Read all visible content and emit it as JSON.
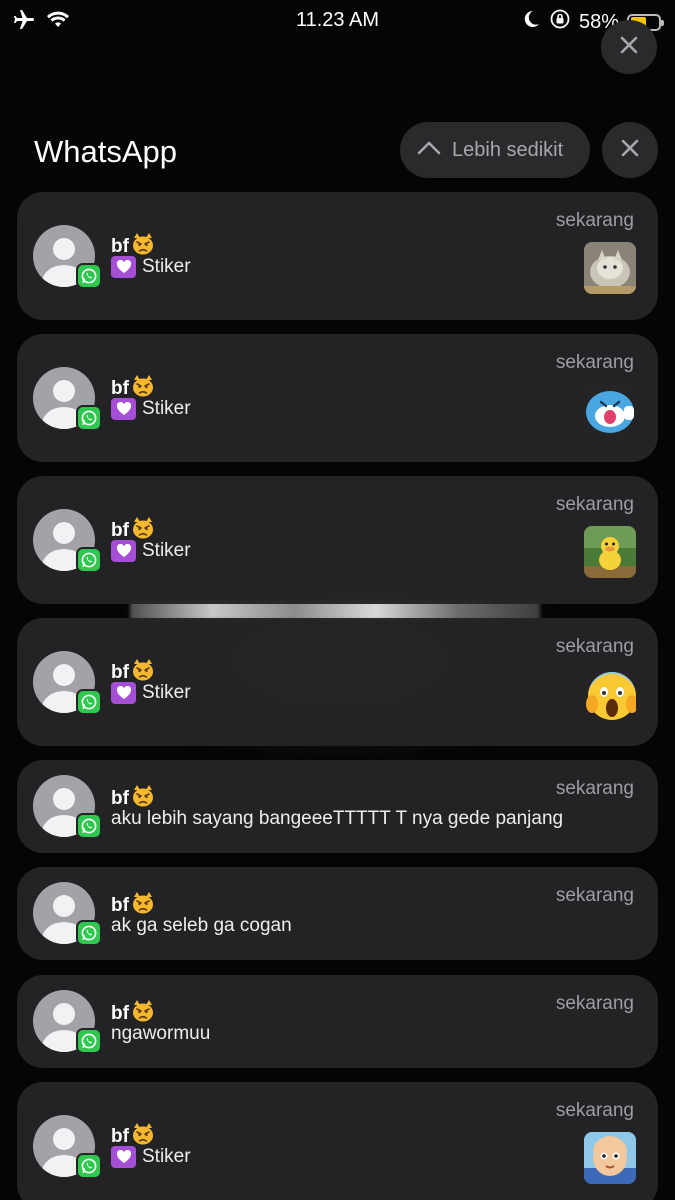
{
  "status_bar": {
    "time": "11.23 AM",
    "battery": "58%",
    "battery_level": 0.58,
    "icons": [
      "airplane-icon",
      "wifi-icon",
      "moon-icon",
      "orientation-lock-icon",
      "battery-icon"
    ]
  },
  "group": {
    "app_name": "WhatsApp",
    "show_less_label": "Lebih sedikit"
  },
  "notifications": [
    {
      "sender": "bf",
      "message": "Stiker",
      "time": "sekarang",
      "sticker": "cat-photo"
    },
    {
      "sender": "bf",
      "message": "Stiker",
      "time": "sekarang",
      "sticker": "blue-cat-cartoon"
    },
    {
      "sender": "bf",
      "message": "Stiker",
      "time": "sekarang",
      "sticker": "duck-character"
    },
    {
      "sender": "bf",
      "message": "Stiker",
      "time": "sekarang",
      "sticker": "screaming-face-emoji"
    },
    {
      "sender": "bf",
      "message": "aku lebih sayang bangeeeTTTTT T nya gede panjang",
      "time": "sekarang"
    },
    {
      "sender": "bf",
      "message": "ak ga seleb ga cogan",
      "time": "sekarang"
    },
    {
      "sender": "bf",
      "message": "ngawormuu",
      "time": "sekarang"
    },
    {
      "sender": "bf",
      "message": "Stiker",
      "time": "sekarang",
      "sticker": "cartoon-boy"
    }
  ],
  "colors": {
    "card_bg": "#242426",
    "whatsapp_green": "#2fc84f",
    "battery_yellow": "#f7c500",
    "sticker_heart": "#a44fd6"
  }
}
